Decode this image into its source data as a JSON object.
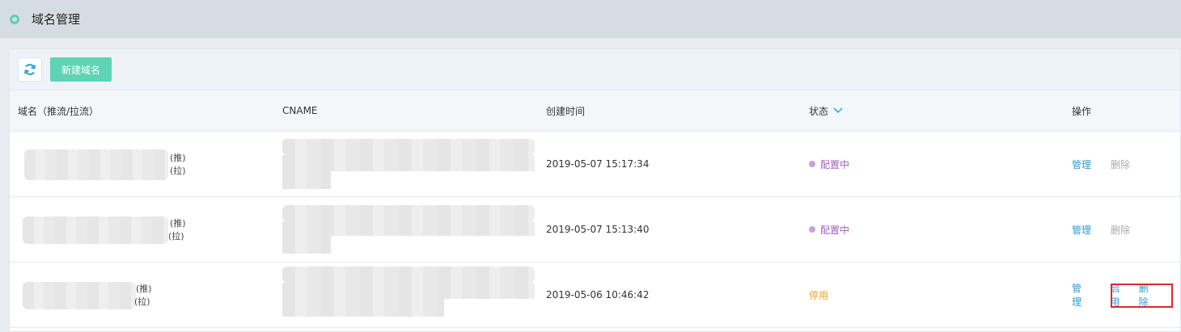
{
  "page": {
    "title": "域名管理"
  },
  "toolbar": {
    "refresh_icon": "refresh-icon",
    "new_domain_label": "新建域名"
  },
  "table": {
    "headers": {
      "domain": "域名（推流/拉流）",
      "cname": "CNAME",
      "created": "创建时间",
      "status": "状态",
      "actions": "操作"
    },
    "rows": [
      {
        "push_tag": "(推)",
        "pull_tag": "(拉)",
        "created": "2019-05-07 15:17:34",
        "status": "配置中",
        "status_color": "#a55dc0",
        "actions": [
          "管理",
          "删除"
        ]
      },
      {
        "push_tag": "(推)",
        "pull_tag": "(拉)",
        "created": "2019-05-07 15:13:40",
        "status": "配置中",
        "status_color": "#a55dc0",
        "actions": [
          "管理",
          "删除"
        ]
      },
      {
        "push_tag": "(推)",
        "pull_tag": "(拉)",
        "created": "2019-05-06 10:46:42",
        "status": "停用",
        "status_color": "#e8a628",
        "actions": [
          "管理",
          "启用",
          "删除"
        ]
      }
    ]
  },
  "colors": {
    "accent": "#5fd3b6",
    "link": "#2a9fd6",
    "highlight_box": "#e0282e"
  }
}
